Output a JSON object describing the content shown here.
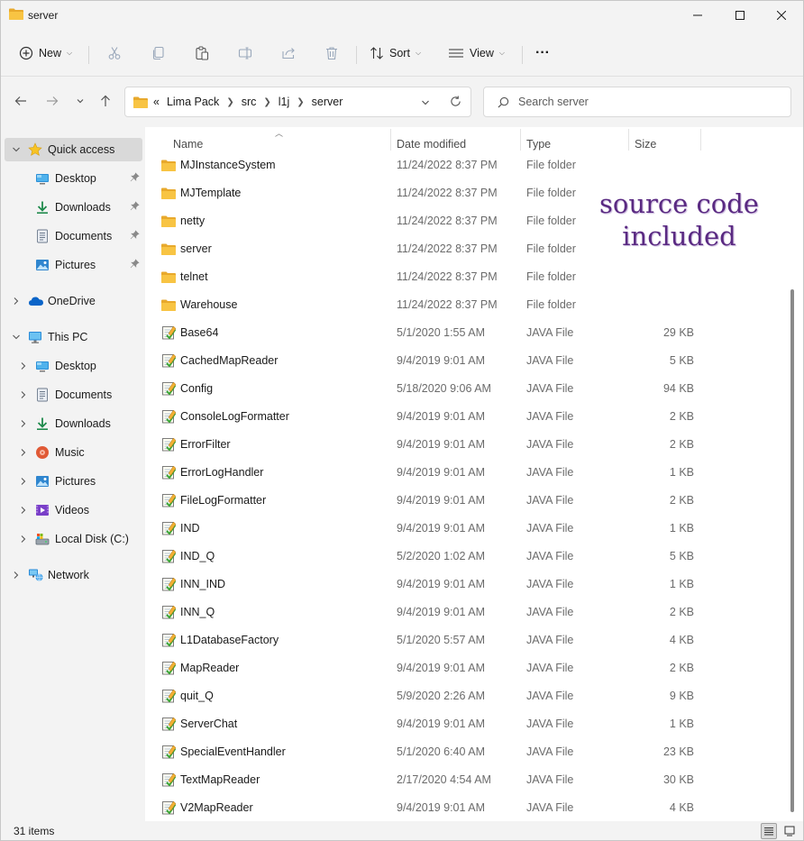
{
  "window": {
    "title": "server"
  },
  "commandbar": {
    "new_label": "New",
    "sort_label": "Sort",
    "view_label": "View",
    "more_label": "···"
  },
  "address": {
    "overflow": "«",
    "crumbs": [
      "Lima Pack",
      "src",
      "l1j",
      "server"
    ]
  },
  "search": {
    "placeholder": "Search server"
  },
  "nav": {
    "items": [
      {
        "label": "Quick access",
        "icon": "star-icon",
        "pinned": false
      },
      {
        "label": "Desktop",
        "icon": "desktop-icon",
        "pinned": true
      },
      {
        "label": "Downloads",
        "icon": "download-icon",
        "pinned": true
      },
      {
        "label": "Documents",
        "icon": "documents-icon",
        "pinned": true
      },
      {
        "label": "Pictures",
        "icon": "pictures-icon",
        "pinned": true
      },
      {
        "label": "OneDrive",
        "icon": "cloud-icon",
        "pinned": false
      },
      {
        "label": "This PC",
        "icon": "computer-icon",
        "pinned": false
      },
      {
        "label": "Desktop",
        "icon": "desktop-icon",
        "pinned": false
      },
      {
        "label": "Documents",
        "icon": "documents-icon",
        "pinned": false
      },
      {
        "label": "Downloads",
        "icon": "download-icon",
        "pinned": false
      },
      {
        "label": "Music",
        "icon": "music-icon",
        "pinned": false
      },
      {
        "label": "Pictures",
        "icon": "pictures-icon",
        "pinned": false
      },
      {
        "label": "Videos",
        "icon": "videos-icon",
        "pinned": false
      },
      {
        "label": "Local Disk (C:)",
        "icon": "disk-icon",
        "pinned": false
      },
      {
        "label": "Network",
        "icon": "network-icon",
        "pinned": false
      }
    ]
  },
  "columns": {
    "name": "Name",
    "date": "Date modified",
    "type": "Type",
    "size": "Size"
  },
  "files": [
    {
      "name": "MJInstanceSystem",
      "date": "11/24/2022 8:37 PM",
      "type": "File folder",
      "size": "",
      "kind": "folder"
    },
    {
      "name": "MJTemplate",
      "date": "11/24/2022 8:37 PM",
      "type": "File folder",
      "size": "",
      "kind": "folder"
    },
    {
      "name": "netty",
      "date": "11/24/2022 8:37 PM",
      "type": "File folder",
      "size": "",
      "kind": "folder"
    },
    {
      "name": "server",
      "date": "11/24/2022 8:37 PM",
      "type": "File folder",
      "size": "",
      "kind": "folder"
    },
    {
      "name": "telnet",
      "date": "11/24/2022 8:37 PM",
      "type": "File folder",
      "size": "",
      "kind": "folder"
    },
    {
      "name": "Warehouse",
      "date": "11/24/2022 8:37 PM",
      "type": "File folder",
      "size": "",
      "kind": "folder"
    },
    {
      "name": "Base64",
      "date": "5/1/2020 1:55 AM",
      "type": "JAVA File",
      "size": "29 KB",
      "kind": "java"
    },
    {
      "name": "CachedMapReader",
      "date": "9/4/2019 9:01 AM",
      "type": "JAVA File",
      "size": "5 KB",
      "kind": "java"
    },
    {
      "name": "Config",
      "date": "5/18/2020 9:06 AM",
      "type": "JAVA File",
      "size": "94 KB",
      "kind": "java"
    },
    {
      "name": "ConsoleLogFormatter",
      "date": "9/4/2019 9:01 AM",
      "type": "JAVA File",
      "size": "2 KB",
      "kind": "java"
    },
    {
      "name": "ErrorFilter",
      "date": "9/4/2019 9:01 AM",
      "type": "JAVA File",
      "size": "2 KB",
      "kind": "java"
    },
    {
      "name": "ErrorLogHandler",
      "date": "9/4/2019 9:01 AM",
      "type": "JAVA File",
      "size": "1 KB",
      "kind": "java"
    },
    {
      "name": "FileLogFormatter",
      "date": "9/4/2019 9:01 AM",
      "type": "JAVA File",
      "size": "2 KB",
      "kind": "java"
    },
    {
      "name": "IND",
      "date": "9/4/2019 9:01 AM",
      "type": "JAVA File",
      "size": "1 KB",
      "kind": "java"
    },
    {
      "name": "IND_Q",
      "date": "5/2/2020 1:02 AM",
      "type": "JAVA File",
      "size": "5 KB",
      "kind": "java"
    },
    {
      "name": "INN_IND",
      "date": "9/4/2019 9:01 AM",
      "type": "JAVA File",
      "size": "1 KB",
      "kind": "java"
    },
    {
      "name": "INN_Q",
      "date": "9/4/2019 9:01 AM",
      "type": "JAVA File",
      "size": "2 KB",
      "kind": "java"
    },
    {
      "name": "L1DatabaseFactory",
      "date": "5/1/2020 5:57 AM",
      "type": "JAVA File",
      "size": "4 KB",
      "kind": "java"
    },
    {
      "name": "MapReader",
      "date": "9/4/2019 9:01 AM",
      "type": "JAVA File",
      "size": "2 KB",
      "kind": "java"
    },
    {
      "name": "quit_Q",
      "date": "5/9/2020 2:26 AM",
      "type": "JAVA File",
      "size": "9 KB",
      "kind": "java"
    },
    {
      "name": "ServerChat",
      "date": "9/4/2019 9:01 AM",
      "type": "JAVA File",
      "size": "1 KB",
      "kind": "java"
    },
    {
      "name": "SpecialEventHandler",
      "date": "5/1/2020 6:40 AM",
      "type": "JAVA File",
      "size": "23 KB",
      "kind": "java"
    },
    {
      "name": "TextMapReader",
      "date": "2/17/2020 4:54 AM",
      "type": "JAVA File",
      "size": "30 KB",
      "kind": "java"
    },
    {
      "name": "V2MapReader",
      "date": "9/4/2019 9:01 AM",
      "type": "JAVA File",
      "size": "4 KB",
      "kind": "java"
    }
  ],
  "overlay": {
    "line1": "source code",
    "line2": "included"
  },
  "status": {
    "items_text": "31 items"
  },
  "colors": {
    "accent": "#0067c0",
    "folder": "#f8c443",
    "overlay_text": "#5a2a82"
  }
}
